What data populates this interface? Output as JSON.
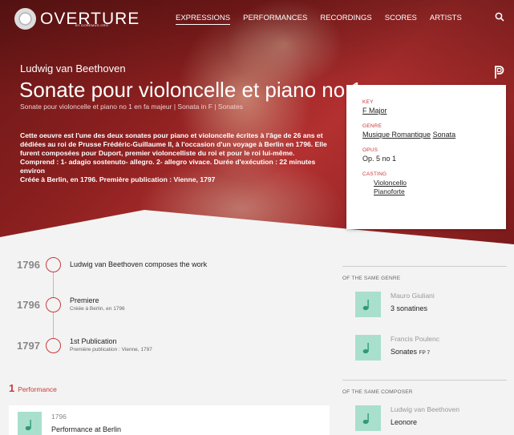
{
  "nav": {
    "logo_text": "OVERTURE",
    "logo_sub": "BY DOREMUS.ORG",
    "links": [
      {
        "label": "EXPRESSIONS",
        "active": true
      },
      {
        "label": "PERFORMANCES",
        "active": false
      },
      {
        "label": "RECORDINGS",
        "active": false
      },
      {
        "label": "SCORES",
        "active": false
      },
      {
        "label": "ARTISTS",
        "active": false
      }
    ],
    "search_icon": "search-icon"
  },
  "hero": {
    "composer": "Ludwig van Beethoven",
    "title": "Sonate pour violoncelle et piano no 1",
    "subtitle": "Sonate pour violoncelle et piano no 1 en fa majeur | Sonata in F | Sonates",
    "description": [
      "Cette oeuvre est l'une des deux sonates pour piano et violoncelle écrites à l'âge de 26 ans et dédiées au roi de Prusse Frédéric-Guillaume II, à l'occasion d'un voyage à Berlin en 1796. Elle furent composées pour Duport, premier violoncelliste du roi et pour le roi lui-même.",
      "Comprend : 1- adagio sostenuto- allegro. 2- allegro vivace. Durée d'exécution : 22 minutes environ",
      "Créée à Berlin, en 1796. Première publication : Vienne, 1797"
    ],
    "accent_color": "#c83a3a"
  },
  "info": {
    "key_label": "KEY",
    "key_value": "F Major",
    "genre_label": "GENRE",
    "genre_values": [
      "Musique Romantique",
      "Sonata"
    ],
    "opus_label": "OPUS",
    "opus_value": "Op. 5 no 1",
    "casting_label": "CASTING",
    "casting_values": [
      "Violoncello",
      "Pianoforte"
    ]
  },
  "timeline": [
    {
      "year": "1796",
      "title": "Ludwig van Beethoven composes the work",
      "sub": ""
    },
    {
      "year": "1796",
      "title": "Premiere",
      "sub": "Créée à Berlin, en 1796"
    },
    {
      "year": "1797",
      "title": "1st Publication",
      "sub": "Première publication : Vienne, 1797"
    }
  ],
  "performances": {
    "count": "1",
    "label": "Performance",
    "items": [
      {
        "year": "1796",
        "title": "Performance at Berlin"
      }
    ]
  },
  "sidebar": {
    "same_genre_title": "OF THE SAME GENRE",
    "same_genre": [
      {
        "composer": "Mauro Giuliani",
        "work": "3 sonatines",
        "catalog": ""
      },
      {
        "composer": "Francis Poulenc",
        "work": "Sonates",
        "catalog": "FP 7"
      }
    ],
    "same_composer_title": "OF THE SAME COMPOSER",
    "same_composer": [
      {
        "composer": "Ludwig van Beethoven",
        "work": "Leonore",
        "catalog": ""
      }
    ],
    "thumb_color": "#a9dfcd"
  }
}
